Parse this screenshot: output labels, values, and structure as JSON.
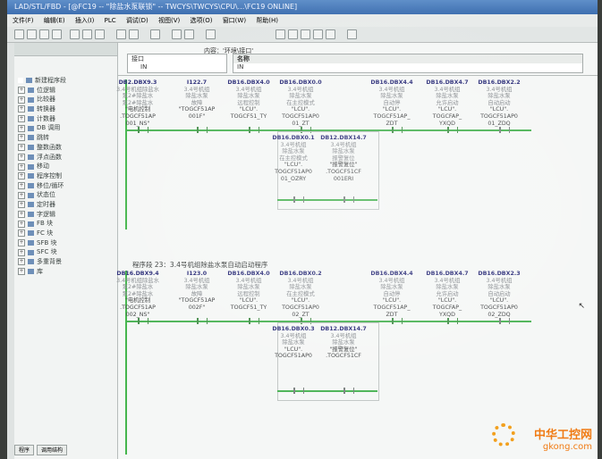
{
  "window": {
    "title": "LAD/STL/FBD - [@FC19 -- \"除盐水泵联锁\" -- TWCYS\\TWCYS\\CPU\\...\\FC19 ONLINE]"
  },
  "menu": [
    "文件(F)",
    "编辑(E)",
    "插入(I)",
    "PLC",
    "调试(D)",
    "视图(V)",
    "选项(O)",
    "窗口(W)",
    "帮助(H)"
  ],
  "sidebar": {
    "items": [
      "新建程序段",
      "位逻辑",
      "比较器",
      "转换器",
      "计数器",
      "DB 调用",
      "跳转",
      "整数函数",
      "浮点函数",
      "移动",
      "程序控制",
      "移位/循环",
      "状态位",
      "定时器",
      "字逻辑",
      "FB 块",
      "FC 块",
      "SFB 块",
      "SFC 块",
      "多重背景",
      "库"
    ],
    "tabs": [
      "程序",
      "调用结构"
    ]
  },
  "interface": {
    "content_label": "内容：'环境\\接口'",
    "tree_root": "接口",
    "tree_child": "IN",
    "name_header": "名称",
    "name_value": "IN"
  },
  "network1": {
    "contacts": [
      {
        "addr": "DB2.DBX9.3",
        "cmt1": "3.4号机组除盐水",
        "cmt2": "泵2#除盐水",
        "cmt3": "泵2#除盐水",
        "desc": "\"电机控制",
        "sym1": ".TOGCF51AP",
        "sym2": "001_NS\""
      },
      {
        "addr": "I122.7",
        "cmt1": "3.4号机组",
        "cmt2": "除盐水泵",
        "cmt3": "故障",
        "desc": "\"TOGCF51AP",
        "sym1": "001F\"",
        "sym2": ""
      },
      {
        "addr": "DB16.DBX4.0",
        "cmt1": "3.4号机组",
        "cmt2": "除盐水泵",
        "cmt3": "远程控制",
        "desc": "\"LCU\".",
        "sym1": "TOGCF51_TY",
        "sym2": ""
      },
      {
        "addr": "DB16.DBX0.0",
        "cmt1": "3.4号机组",
        "cmt2": "除盐水泵",
        "cmt3": "在主控模式",
        "desc": "\"LCU\".",
        "sym1": "TOGCF51AP0",
        "sym2": "01_ZT"
      },
      {
        "addr": "DB16.DBX4.4",
        "cmt1": "3.4号机组",
        "cmt2": "除盐水泵",
        "cmt3": "自动停",
        "desc": "\"LCU\".",
        "sym1": "TOGCF51AP_",
        "sym2": "ZDT"
      },
      {
        "addr": "DB16.DBX4.7",
        "cmt1": "3.4号机组",
        "cmt2": "除盐水泵",
        "cmt3": "允许启动",
        "desc": "\"LCU\".",
        "sym1": "TOGCFAP_",
        "sym2": "YXQD"
      },
      {
        "addr": "DB16.DBX2.2",
        "cmt1": "3.4号机组",
        "cmt2": "除盐水泵",
        "cmt3": "自动启动",
        "desc": "\"LCU\".",
        "sym1": "TOGCF51AP0",
        "sym2": "01_ZDQ"
      }
    ],
    "branch": [
      {
        "addr": "DB16.DBX0.1",
        "cmt1": "3.4号机组",
        "cmt2": "除盐水泵",
        "cmt3": "在主控模式",
        "desc": "\"LCU\".",
        "sym1": "TOGCF51AP0",
        "sym2": "01_OZRY"
      },
      {
        "addr": "DB12.DBX14.7",
        "cmt1": "3.4号机组",
        "cmt2": "除盐水泵",
        "cmt3": "报警复位",
        "desc": "\"报警复位\"",
        "sym1": ".TOGCF51CF",
        "sym2": "001ERI"
      }
    ]
  },
  "network2": {
    "title": "程序段 23：3.4号机组除盐水泵自动启动程序",
    "contacts": [
      {
        "addr": "DB16.DBX9.4",
        "cmt1": "3.4号机组除盐水",
        "cmt2": "泵2#除盐水",
        "cmt3": "泵2#除盐水",
        "desc": "\"电机控制",
        "sym1": ".TOGCF51AP",
        "sym2": "002_NS\""
      },
      {
        "addr": "I123.0",
        "cmt1": "3.4号机组",
        "cmt2": "除盐水泵",
        "cmt3": "故障",
        "desc": "\"TOGCF51AP",
        "sym1": "002F\"",
        "sym2": ""
      },
      {
        "addr": "DB16.DBX4.0",
        "cmt1": "3.4号机组",
        "cmt2": "除盐水泵",
        "cmt3": "远程控制",
        "desc": "\"LCU\".",
        "sym1": "TOGCF51_TY",
        "sym2": ""
      },
      {
        "addr": "DB16.DBX0.2",
        "cmt1": "3.4号机组",
        "cmt2": "除盐水泵",
        "cmt3": "在主控模式",
        "desc": "\"LCU\".",
        "sym1": "TOGCF51AP0",
        "sym2": "02_ZT"
      },
      {
        "addr": "DB16.DBX4.4",
        "cmt1": "3.4号机组",
        "cmt2": "除盐水泵",
        "cmt3": "自动停",
        "desc": "\"LCU\".",
        "sym1": "TOGCF51AP_",
        "sym2": "ZDT"
      },
      {
        "addr": "DB16.DBX4.7",
        "cmt1": "3.4号机组",
        "cmt2": "除盐水泵",
        "cmt3": "允许启动",
        "desc": "\"LCU\".",
        "sym1": "TOGCFAP_",
        "sym2": "YXQD"
      },
      {
        "addr": "DB16.DBX2.3",
        "cmt1": "3.4号机组",
        "cmt2": "除盐水泵",
        "cmt3": "自动启动",
        "desc": "\"LCU\".",
        "sym1": "TOGCF51AP0",
        "sym2": "02_ZDQ"
      }
    ],
    "branch": [
      {
        "addr": "DB16.DBX0.3",
        "cmt1": "3.4号机组",
        "cmt2": "除盐水泵",
        "cmt3": "",
        "desc": "\"LCU\".",
        "sym1": "TOGCF51AP0",
        "sym2": ""
      },
      {
        "addr": "DB12.DBX14.7",
        "cmt1": "3.4号机组",
        "cmt2": "除盐水泵",
        "cmt3": "",
        "desc": "\"报警复位\"",
        "sym1": ".TOGCF51CF",
        "sym2": ""
      }
    ]
  },
  "watermark": {
    "line1": "中华工控网",
    "line2": "gkong.com"
  },
  "colors": {
    "rung_on": "#4db457",
    "address": "#2d2f7a",
    "comment": "#8a8e92",
    "title_bar": "#3e6fb0"
  }
}
